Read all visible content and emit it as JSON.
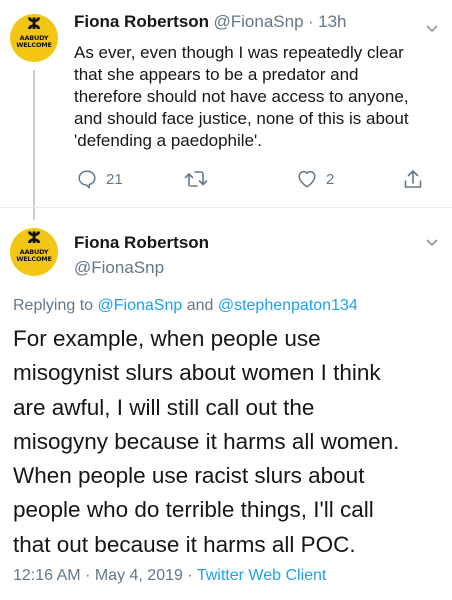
{
  "tweet1": {
    "avatar": {
      "glyph": "ⵣ",
      "line1": "AABUDY",
      "line2": "WELCOME"
    },
    "name": "Fiona Robertson",
    "handle": "@FionaSnp",
    "separator": "·",
    "time": "13h",
    "lines": [
      "As ever, even though I was repeatedly clear",
      "that she appears to be a predator and",
      "therefore should not have access to anyone,",
      "and should face justice, none of this is about",
      "'defending a paedophile'."
    ],
    "actions": {
      "reply_icon": "reply-icon",
      "reply_count": "21",
      "retweet_icon": "retweet-icon",
      "like_icon": "heart-icon",
      "like_count": "2",
      "share_icon": "share-icon"
    }
  },
  "tweet2": {
    "avatar": {
      "glyph": "ⵣ",
      "line1": "AABUDY",
      "line2": "WELCOME"
    },
    "name": "Fiona Robertson",
    "handle": "@FionaSnp",
    "reply_prefix": "Replying to",
    "reply_to_1": "@FionaSnp",
    "reply_and": "and",
    "reply_to_2": "@stephenpaton134",
    "lines": [
      "For example, when people use",
      "misogynist slurs about women I think",
      "are awful, I will still call out the",
      "misogyny because it harms all women.",
      "When people use racist slurs about",
      "people who do terrible things, I'll call",
      "that out because it harms all POC."
    ],
    "time": "12:16 AM",
    "dot1": "·",
    "date": "May 4, 2019",
    "dot2": "·",
    "client": "Twitter Web Client"
  },
  "colors": {
    "link": "#1da1f2",
    "muted": "#657786",
    "text": "#14171a",
    "avatar_bg": "#f3c614"
  }
}
